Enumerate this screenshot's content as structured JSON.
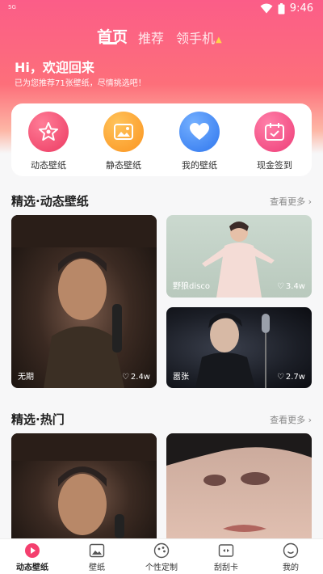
{
  "status_bar": {
    "signal_text": "5G",
    "time": "9:46"
  },
  "top_tabs": [
    {
      "label": "首页",
      "active": true
    },
    {
      "label": "推荐",
      "active": false
    },
    {
      "label": "领手机",
      "active": false
    }
  ],
  "greeting": {
    "title": "Hi，欢迎回来",
    "subtitle": "已为您推荐71张壁纸，尽情挑选吧！"
  },
  "categories": [
    {
      "label": "动态壁纸",
      "icon": "star-icon",
      "color": "#f2476a"
    },
    {
      "label": "静态壁纸",
      "icon": "image-icon",
      "color": "#ffa53a"
    },
    {
      "label": "我的壁纸",
      "icon": "heart-icon",
      "color": "#4a8ff5"
    },
    {
      "label": "现金签到",
      "icon": "calendar-icon",
      "color": "#f44c82"
    }
  ],
  "section_dynamic": {
    "title": "精选·动态壁纸",
    "more": "查看更多",
    "tiles": [
      {
        "caption": "无期",
        "likes": "2.4w"
      },
      {
        "caption": "野狼disco",
        "likes": "3.4w"
      },
      {
        "caption": "嚣张",
        "likes": "2.7w"
      }
    ]
  },
  "section_hot": {
    "title": "精选·热门",
    "more": "查看更多"
  },
  "tab_bar": [
    {
      "label": "动态壁纸",
      "icon": "play-icon",
      "active": true
    },
    {
      "label": "壁纸",
      "icon": "picture-icon",
      "active": false
    },
    {
      "label": "个性定制",
      "icon": "customize-icon",
      "active": false
    },
    {
      "label": "刮刮卡",
      "icon": "scratch-card-icon",
      "active": false
    },
    {
      "label": "我的",
      "icon": "smile-icon",
      "active": false
    }
  ]
}
